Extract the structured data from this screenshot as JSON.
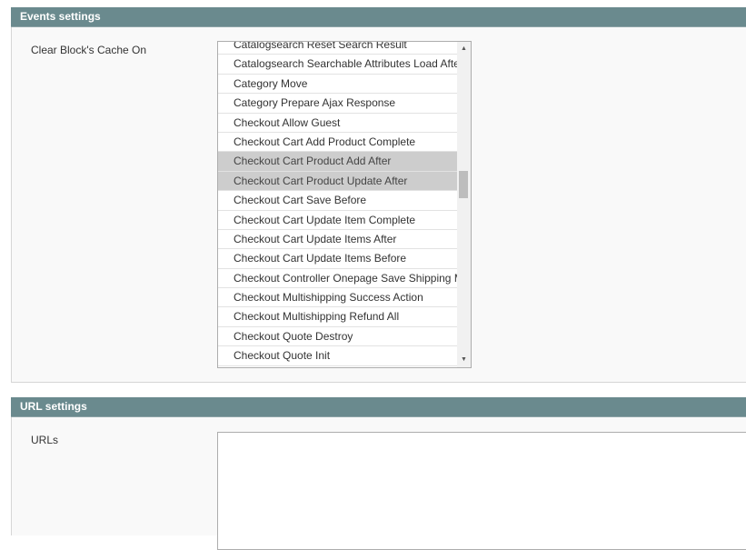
{
  "events_section": {
    "title": "Events settings",
    "field_label": "Clear Block's Cache On",
    "options": [
      {
        "label": "Catalogsearch Reset Search Result",
        "selected": false
      },
      {
        "label": "Catalogsearch Searchable Attributes Load After",
        "selected": false
      },
      {
        "label": "Category Move",
        "selected": false
      },
      {
        "label": "Category Prepare Ajax Response",
        "selected": false
      },
      {
        "label": "Checkout Allow Guest",
        "selected": false
      },
      {
        "label": "Checkout Cart Add Product Complete",
        "selected": false
      },
      {
        "label": "Checkout Cart Product Add After",
        "selected": true
      },
      {
        "label": "Checkout Cart Product Update After",
        "selected": true
      },
      {
        "label": "Checkout Cart Save Before",
        "selected": false
      },
      {
        "label": "Checkout Cart Update Item Complete",
        "selected": false
      },
      {
        "label": "Checkout Cart Update Items After",
        "selected": false
      },
      {
        "label": "Checkout Cart Update Items Before",
        "selected": false
      },
      {
        "label": "Checkout Controller Onepage Save Shipping Method",
        "selected": false
      },
      {
        "label": "Checkout Multishipping Success Action",
        "selected": false
      },
      {
        "label": "Checkout Multishipping Refund All",
        "selected": false
      },
      {
        "label": "Checkout Quote Destroy",
        "selected": false
      },
      {
        "label": "Checkout Quote Init",
        "selected": false
      }
    ],
    "scroll_up_icon": "▲",
    "scroll_down_icon": "▼"
  },
  "url_section": {
    "title": "URL settings",
    "field_label": "URLs",
    "value": ""
  },
  "colors": {
    "header_bg": "#6a8a8e",
    "selected_bg": "#cdcdcd"
  }
}
